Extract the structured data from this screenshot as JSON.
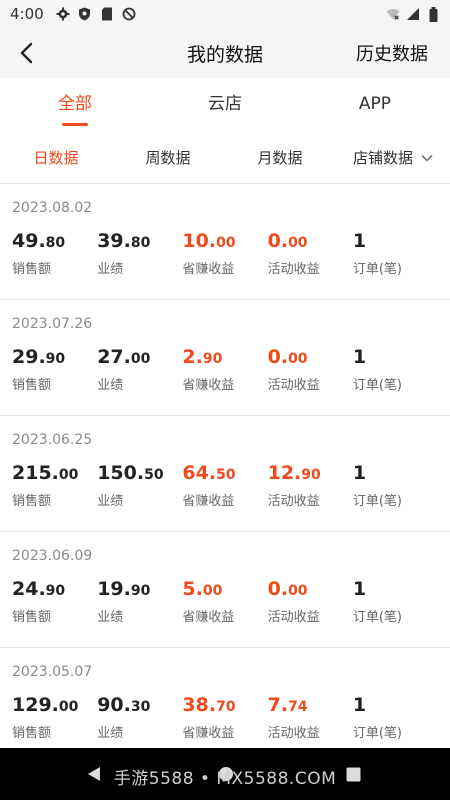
{
  "status_bar": {
    "time": "4:00",
    "left_icons": [
      "gear-icon",
      "shield-icon",
      "sd-card-icon",
      "no-sync-icon"
    ],
    "right_icons": [
      "wifi-icon",
      "signal-icon",
      "battery-icon"
    ]
  },
  "header": {
    "title": "我的数据",
    "history_label": "历史数据"
  },
  "main_tabs": [
    {
      "label": "全部",
      "active": true
    },
    {
      "label": "云店",
      "active": false
    },
    {
      "label": "APP",
      "active": false
    }
  ],
  "sub_tabs": [
    {
      "label": "日数据",
      "active": true
    },
    {
      "label": "周数据",
      "active": false
    },
    {
      "label": "月数据",
      "active": false
    },
    {
      "label": "店铺数据",
      "active": false
    }
  ],
  "labels": {
    "sales": "销售额",
    "performance": "业绩",
    "saved_income": "省赚收益",
    "activity_income": "活动收益",
    "orders": "订单(笔)"
  },
  "records": [
    {
      "date": "2023.08.02",
      "sales_int": "49.",
      "sales_dec": "80",
      "perf_int": "39.",
      "perf_dec": "80",
      "saved_int": "10.",
      "saved_dec": "00",
      "act_int": "0.",
      "act_dec": "00",
      "orders": "1"
    },
    {
      "date": "2023.07.26",
      "sales_int": "29.",
      "sales_dec": "90",
      "perf_int": "27.",
      "perf_dec": "00",
      "saved_int": "2.",
      "saved_dec": "90",
      "act_int": "0.",
      "act_dec": "00",
      "orders": "1"
    },
    {
      "date": "2023.06.25",
      "sales_int": "215.",
      "sales_dec": "00",
      "perf_int": "150.",
      "perf_dec": "50",
      "saved_int": "64.",
      "saved_dec": "50",
      "act_int": "12.",
      "act_dec": "90",
      "orders": "1"
    },
    {
      "date": "2023.06.09",
      "sales_int": "24.",
      "sales_dec": "90",
      "perf_int": "19.",
      "perf_dec": "90",
      "saved_int": "5.",
      "saved_dec": "00",
      "act_int": "0.",
      "act_dec": "00",
      "orders": "1"
    },
    {
      "date": "2023.05.07",
      "sales_int": "129.",
      "sales_dec": "00",
      "perf_int": "90.",
      "perf_dec": "30",
      "saved_int": "38.",
      "saved_dec": "70",
      "act_int": "7.",
      "act_dec": "74",
      "orders": "1"
    }
  ],
  "watermark": "手游5588 • MX5588.COM",
  "colors": {
    "accent": "#f04a1c",
    "text": "#222222",
    "muted": "#8a8a8a"
  }
}
